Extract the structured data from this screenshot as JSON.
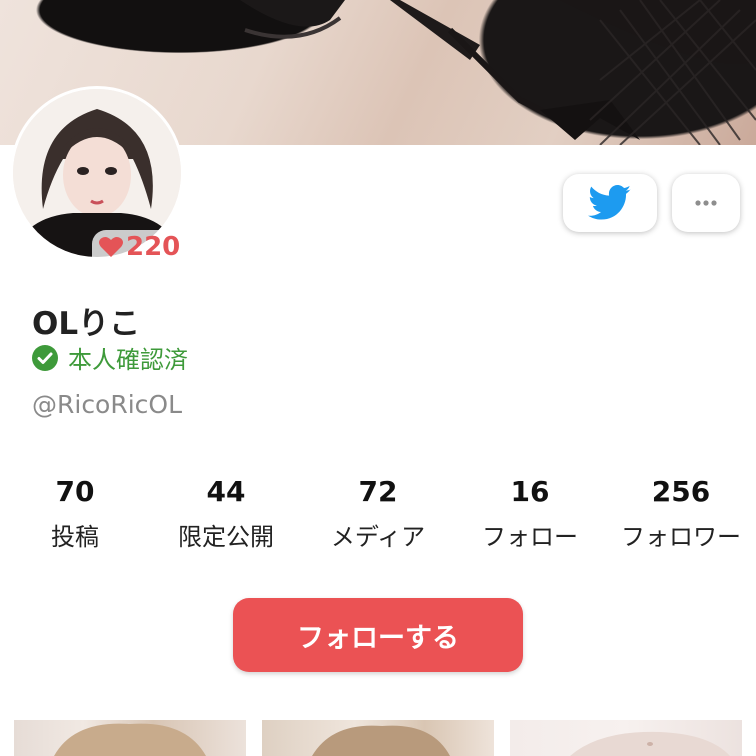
{
  "profile": {
    "name": "OLりこ",
    "verified_label": "本人確認済",
    "handle": "@RicoRicOL",
    "likes": "220"
  },
  "stats": [
    {
      "value": "70",
      "label": "投稿"
    },
    {
      "value": "44",
      "label": "限定公開"
    },
    {
      "value": "72",
      "label": "メディア"
    },
    {
      "value": "16",
      "label": "フォロー"
    },
    {
      "value": "256",
      "label": "フォロワー"
    }
  ],
  "actions": {
    "follow_label": "フォローする",
    "twitter_icon": "twitter-bird-icon",
    "more_icon": "more-dots-icon"
  },
  "colors": {
    "accent": "#eb5254",
    "verified": "#3e9a3a",
    "twitter": "#1d9bf0",
    "heart": "#e45457"
  }
}
